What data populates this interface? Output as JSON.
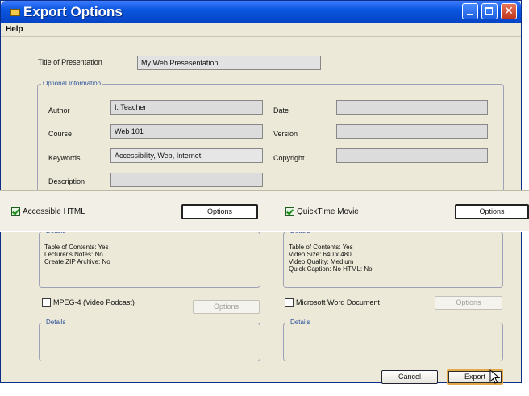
{
  "window": {
    "title": "Export Options",
    "menu": [
      "Help"
    ]
  },
  "presentation": {
    "title_label": "Title of Presentation",
    "title_value": "My Web Presesentation"
  },
  "optional_info": {
    "group_label": "Optional Information",
    "author_label": "Author",
    "author_value": "I. Teacher",
    "course_label": "Course",
    "course_value": "Web 101",
    "keywords_label": "Keywords",
    "keywords_value": "Accessibility, Web, Internet",
    "description_label": "Description",
    "description_value": "",
    "date_label": "Date",
    "date_value": "",
    "version_label": "Version",
    "version_value": "",
    "copyright_label": "Copyright",
    "copyright_value": ""
  },
  "exports": {
    "accessible_html": {
      "label": "Accessible HTML",
      "checked": true,
      "options_label": "Options",
      "details_label": "Details",
      "details": [
        "Table of Contents: Yes",
        "Lecturer's Notes: No",
        "Create ZIP Archive: No"
      ]
    },
    "quicktime": {
      "label": "QuickTime Movie",
      "checked": true,
      "options_label": "Options",
      "details_label": "Details",
      "details": [
        "Table of Contents: Yes",
        "Video Size: 640 x 480",
        "Video Quality: Medium",
        "Quick Caption: No  HTML: No"
      ]
    },
    "mpeg4": {
      "label": "MPEG-4 (Video Podcast)",
      "checked": false,
      "options_label": "Options",
      "details_label": "Details"
    },
    "word": {
      "label": "Microsoft Word Document",
      "checked": false,
      "options_label": "Options",
      "details_label": "Details"
    }
  },
  "footer": {
    "cancel_label": "Cancel",
    "export_label": "Export"
  },
  "colors": {
    "titlebar": "#0a56e0",
    "dialog_bg": "#ece9d8",
    "group_title": "#2b4f9a",
    "default_button_ring": "#e2a94a"
  }
}
